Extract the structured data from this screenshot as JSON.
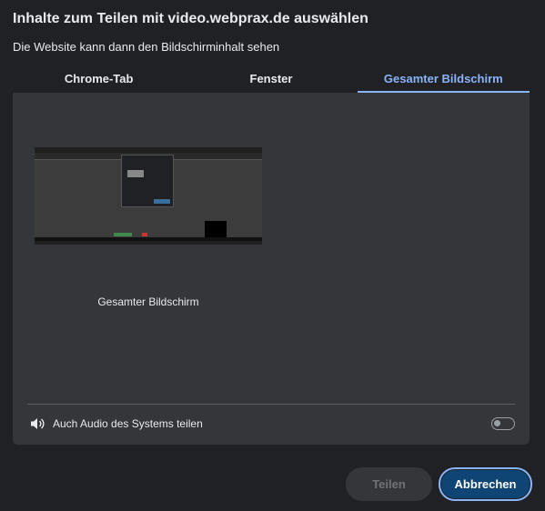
{
  "dialog": {
    "title": "Inhalte zum Teilen mit video.webprax.de auswählen",
    "subtitle": "Die Website kann dann den Bildschirminhalt sehen"
  },
  "tabs": [
    {
      "label": "Chrome-Tab",
      "active": false
    },
    {
      "label": "Fenster",
      "active": false
    },
    {
      "label": "Gesamter Bildschirm",
      "active": true
    }
  ],
  "sources": [
    {
      "label": "Gesamter Bildschirm",
      "selected": false
    }
  ],
  "audio": {
    "label": "Auch Audio des Systems teilen",
    "enabled": false,
    "icon": "speaker-icon"
  },
  "buttons": {
    "share_label": "Teilen",
    "share_enabled": false,
    "cancel_label": "Abbrechen"
  },
  "colors": {
    "background": "#202124",
    "panel": "#35363a",
    "accent": "#8ab4f8",
    "cancel_button": "#0e4574"
  }
}
